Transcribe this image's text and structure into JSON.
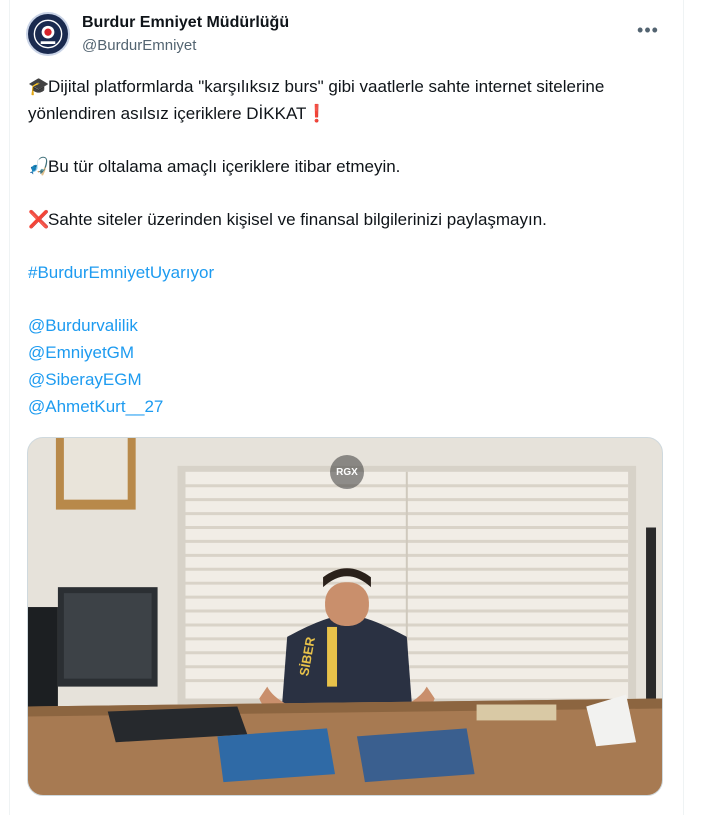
{
  "account": {
    "name": "Burdur Emniyet Müdürlüğü",
    "handle": "@BurdurEmniyet"
  },
  "more_menu_icon": "more-horizontal-icon",
  "tweet": {
    "line1_emoji": "🎓",
    "line1_text": "Dijital platformlarda \"karşılıksız burs\" gibi vaatlerle sahte internet sitelerine yönlendiren asılsız içeriklere DİKKAT",
    "line1_end_emoji": "❗",
    "line2_emoji": "🎣",
    "line2_text": "Bu tür oltalama amaçlı içeriklere itibar etmeyin.",
    "line3_emoji": "❌",
    "line3_text": "Sahte siteler üzerinden kişisel ve finansal bilgilerinizi paylaşmayın.",
    "hashtag": "#BurdurEmniyetUyarıyor",
    "mentions": [
      "@Burdurvalilik",
      "@EmniyetGM",
      "@SiberayEGM",
      "@AhmetKurt__27"
    ]
  },
  "media": {
    "watermark": "RGX",
    "vest_text": "SİBER"
  },
  "colors": {
    "link": "#1d9bf0",
    "text": "#0f1419",
    "secondary": "#536471"
  }
}
